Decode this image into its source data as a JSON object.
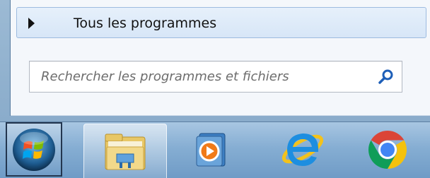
{
  "start_menu": {
    "all_programs_label": "Tous les programmes",
    "search": {
      "placeholder": "Rechercher les programmes et fichiers",
      "value": ""
    }
  },
  "taskbar": {
    "start_button_icon": "windows-orb-icon",
    "pinned": [
      {
        "icon": "windows-explorer-icon"
      },
      {
        "icon": "windows-media-player-icon"
      },
      {
        "icon": "internet-explorer-icon"
      },
      {
        "icon": "google-chrome-icon"
      }
    ]
  },
  "colors": {
    "taskbar_top": "#a8c6e2",
    "taskbar_bottom": "#6f9bc6",
    "menu_background": "#f4f7fb",
    "highlight": "#d7e6f7"
  }
}
